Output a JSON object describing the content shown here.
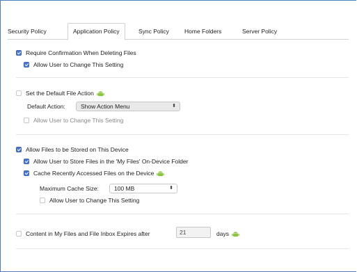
{
  "tabs": [
    {
      "label": "Security Policy",
      "active": false
    },
    {
      "label": "Application Policy",
      "active": true
    },
    {
      "label": "Sync Policy",
      "active": false
    },
    {
      "label": "Home Folders",
      "active": false
    },
    {
      "label": "Server Policy",
      "active": false
    }
  ],
  "confirm_delete": {
    "label": "Require Confirmation When Deleting Files",
    "checked": true,
    "allow_change": {
      "label": "Allow User to Change This Setting",
      "checked": true
    }
  },
  "default_action": {
    "label": "Set the Default File Action",
    "checked": false,
    "field_label": "Default Action:",
    "selected": "Show Action Menu",
    "allow_change": {
      "label": "Allow User to Change This Setting",
      "checked": false
    }
  },
  "store_files": {
    "label": "Allow Files to be Stored on This Device",
    "checked": true,
    "my_files": {
      "label": "Allow User to Store Files in the 'My Files' On-Device Folder",
      "checked": true
    },
    "cache": {
      "label": "Cache Recently Accessed Files on the Device",
      "checked": true
    },
    "cache_size_label": "Maximum Cache Size:",
    "cache_size_selected": "100 MB",
    "allow_change": {
      "label": "Allow User to Change This Setting",
      "checked": false
    }
  },
  "expiry": {
    "label": "Content in My Files and File Inbox Expires after",
    "checked": false,
    "days_value": "21",
    "days_unit": "days"
  },
  "colors": {
    "accent": "#4a78d6",
    "android": "#8bc53f",
    "frame": "#4a7fc0"
  },
  "icons": {
    "android": "android-icon",
    "select_arrows": "updown-arrows-icon"
  }
}
